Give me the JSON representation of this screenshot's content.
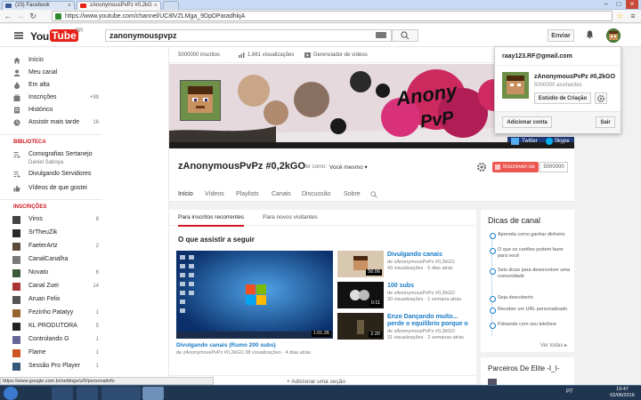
{
  "browser": {
    "tabs": [
      {
        "label": "(23) Facebook",
        "active": false
      },
      {
        "label": "zAnonymousPvPz #0,2kG",
        "active": true
      }
    ],
    "url": "https://www.youtube.com/channel/UC8lVZLMga_9DpDParadhkjA"
  },
  "header": {
    "logo_you": "You",
    "logo_tube": "Tube",
    "logo_region": "BR",
    "search_value": "zanonymouspvpz",
    "upload_label": "Enviar"
  },
  "sidebar": {
    "main": [
      {
        "label": "Início",
        "icon": "home-icon",
        "count": ""
      },
      {
        "label": "Meu canal",
        "icon": "user-icon",
        "count": ""
      },
      {
        "label": "Em alta",
        "icon": "flame-icon",
        "count": ""
      },
      {
        "label": "Inscrições",
        "icon": "subscriptions-icon",
        "count": "+99"
      },
      {
        "label": "Histórico",
        "icon": "history-icon",
        "count": ""
      },
      {
        "label": "Assistir mais tarde",
        "icon": "clock-icon",
        "count": "16"
      }
    ],
    "library_heading": "BIBLIOTECA",
    "library": [
      {
        "label": "Comografias Sertanejo",
        "sub": "Daniel Saboya"
      },
      {
        "label": "Divulgando Servidores",
        "sub": ""
      },
      {
        "label": "Vídeos de que gostei",
        "sub": ""
      }
    ],
    "subs_heading": "INSCRIÇÕES",
    "subscriptions": [
      {
        "label": "Viros",
        "count": "8",
        "color": "#444444"
      },
      {
        "label": "SrTheuZik",
        "count": "",
        "color": "#2a2a2a"
      },
      {
        "label": "FaeterArtz",
        "count": "2",
        "color": "#5a4a3a"
      },
      {
        "label": "CanalCanalha",
        "count": "",
        "color": "#7a7a7a"
      },
      {
        "label": "Novato",
        "count": "6",
        "color": "#3a5a3a"
      },
      {
        "label": "Canal Zuei",
        "count": "14",
        "color": "#aa3333"
      },
      {
        "label": "Aruan Felix",
        "count": "",
        "color": "#555555"
      },
      {
        "label": "Fezinho Patatyy",
        "count": "1",
        "color": "#996633"
      },
      {
        "label": "KL PRODUTORA",
        "count": "5",
        "color": "#222222"
      },
      {
        "label": "Controlando G",
        "count": "1",
        "color": "#666699"
      },
      {
        "label": "Flame",
        "count": "1",
        "color": "#cc5522"
      },
      {
        "label": "Sessão Pro Player",
        "count": "1",
        "color": "#335577"
      }
    ]
  },
  "channel": {
    "stats": {
      "subscribers": "5000000 inscritos",
      "views": "1.861 visualizações",
      "manager": "Gerenciador de vídeos"
    },
    "banner_text_1": "Anony",
    "banner_text_2": "PvP",
    "banner_social": [
      "Twitter",
      "Skype",
      "X"
    ],
    "name": "zAnonymousPvPz #0,2kGO",
    "view_as_label": "Ver como:",
    "view_as_value": "Você mesmo",
    "subscribe_label": "Inscrever-se",
    "subscribe_count": "5000000",
    "tabs": [
      "Início",
      "Vídeos",
      "Playlists",
      "Canais",
      "Discussão",
      "Sobre"
    ],
    "active_tab": "Início"
  },
  "home": {
    "view_tabs": [
      "Para inscritos recorrentes",
      "Para novos visitantes"
    ],
    "section_title": "O que assistir a seguir",
    "featured": {
      "title": "Divulgando canais (Rumo 200 subs)",
      "meta": "de zAnonymousPvPz #0,2kGO   38 visualizações · 4 dias atrás",
      "duration": "1:01:26"
    },
    "side_videos": [
      {
        "title": "Divulgando canais",
        "channel": "de zAnonymousPvPz #0,2kGO",
        "meta": "43 visualizações · 5 dias atrás",
        "duration": "56:06"
      },
      {
        "title": "100 subs",
        "channel": "de zAnonymousPvPz #0,2kGO",
        "meta": "30 visualizações · 1 semana atrás",
        "duration": "0:11"
      },
      {
        "title": "Enzo Dançando muito... perde o equilíbrio porque o",
        "channel": "de zAnonymousPvPz #0,2kGO",
        "meta": "31 visualizações · 2 semanas atrás",
        "duration": "2:20"
      }
    ],
    "add_section": "Adicionar uma seção"
  },
  "tips": {
    "title": "Dicas de canal",
    "items": [
      "Aprenda como ganhar dinheiro",
      "O que os cartões podem fazer para você",
      "Seis dicas para desenvolver uma comunidade",
      "Seja descoberto",
      "Receber um URL personalizado",
      "Filmando com seu telefone"
    ],
    "see_all": "Ver todas ▸"
  },
  "partners": {
    "title": "Parceiros De Elite -I_I-"
  },
  "account_menu": {
    "email": "raay123.RF@gmail.com",
    "channel_name": "zAnonymousPvPz #0,2kGO",
    "subscribers": "5000000 assinantes",
    "studio_label": "Estúdio de Criação",
    "add_account": "Adicionar conta",
    "logout": "Sair"
  },
  "status_url": "https://www.google.com.br/settings/u/0/personalinfo",
  "taskbar": {
    "lang": "PT",
    "time": "19:47",
    "date": "02/06/2016"
  },
  "colors": {
    "youtube_red": "#e62117",
    "link_blue": "#167ac6",
    "taskbar": "#1f3550"
  }
}
